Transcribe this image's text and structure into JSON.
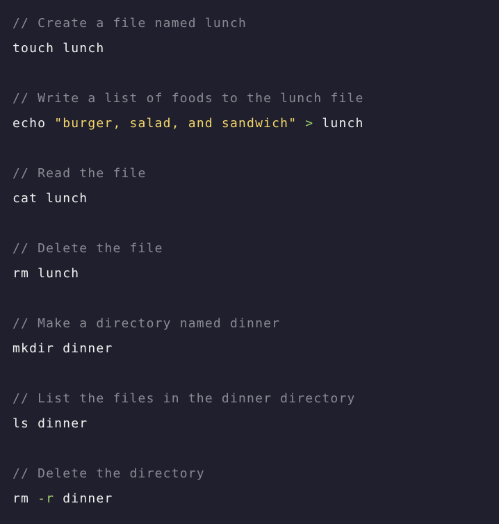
{
  "colors": {
    "background": "#201f2d",
    "comment": "#8b8a94",
    "command": "#f1f1f1",
    "string": "#f4d76b",
    "operator": "#9fd16b"
  },
  "blocks": [
    {
      "comment": "// Create a file named lunch",
      "command": "touch lunch"
    },
    {
      "comment": "// Write a list of foods to the lunch file",
      "command_parts": {
        "cmd": "echo ",
        "string": "\"burger, salad, and sandwich\"",
        "op": " > ",
        "arg": "lunch"
      }
    },
    {
      "comment": "// Read the file",
      "command": "cat lunch"
    },
    {
      "comment": "// Delete the file",
      "command": "rm lunch"
    },
    {
      "comment": "// Make a directory named dinner",
      "command": "mkdir dinner"
    },
    {
      "comment": "// List the files in the dinner directory",
      "command": "ls dinner"
    },
    {
      "comment": "// Delete the directory",
      "command_parts": {
        "cmd": "rm ",
        "flag": "-r",
        "arg": " dinner"
      }
    }
  ]
}
